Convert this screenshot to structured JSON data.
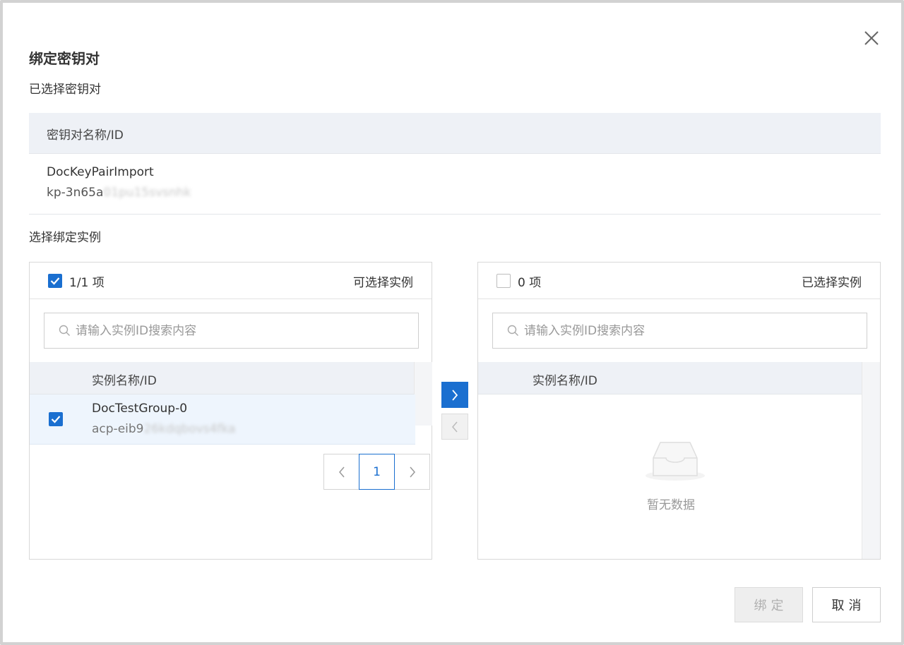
{
  "dialog": {
    "title": "绑定密钥对",
    "selected_keypair_label": "已选择密钥对",
    "keypair_table": {
      "column_header": "密钥对名称/ID",
      "row": {
        "name": "DocKeyPairImport",
        "id_visible": "kp-3n65a",
        "id_blurred": "01pu15svsnhk"
      }
    },
    "select_instance_label": "选择绑定实例",
    "available": {
      "count_label": "1/1 项",
      "title": "可选择实例",
      "all_checked": true,
      "search_placeholder": "请输入实例ID搜索内容",
      "column_header": "实例名称/ID",
      "rows": [
        {
          "name": "DocTestGroup-0",
          "id_visible": "acp-eib9",
          "id_blurred": "26kdqbovs4fka",
          "checked": true
        }
      ],
      "pagination": {
        "current_page": "1"
      }
    },
    "selected": {
      "count_label": "0 项",
      "title": "已选择实例",
      "all_checked": false,
      "search_placeholder": "请输入实例ID搜索内容",
      "column_header": "实例名称/ID",
      "empty_text": "暂无数据"
    },
    "buttons": {
      "bind": "绑定",
      "cancel": "取消"
    },
    "colors": {
      "primary": "#1a6fd0",
      "table_header_bg": "#eef1f6",
      "selected_row_bg": "#eef5fd"
    }
  }
}
